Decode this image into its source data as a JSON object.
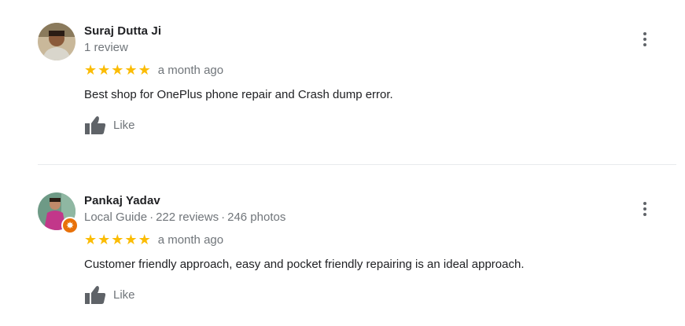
{
  "reviews": [
    {
      "name": "Suraj Dutta Ji",
      "meta": [
        "1 review"
      ],
      "stars": 5,
      "time": "a month ago",
      "text": "Best shop for OnePlus phone repair and Crash dump error.",
      "like_label": "Like",
      "local_guide": false
    },
    {
      "name": "Pankaj Yadav",
      "meta": [
        "Local Guide",
        "222 reviews",
        "246 photos"
      ],
      "meta_separator": "·",
      "stars": 5,
      "time": "a month ago",
      "text": "Customer friendly approach, easy and pocket friendly repairing is an ideal approach.",
      "like_label": "Like",
      "local_guide": true
    }
  ],
  "icons": {
    "star": "star-icon",
    "like": "thumbs-up-icon",
    "more": "more-vert-icon",
    "badge": "local-guide-badge-icon"
  },
  "colors": {
    "star": "#fbbc04",
    "secondary_text": "#70757a",
    "primary_text": "#202124",
    "badge": "#e8710a"
  }
}
